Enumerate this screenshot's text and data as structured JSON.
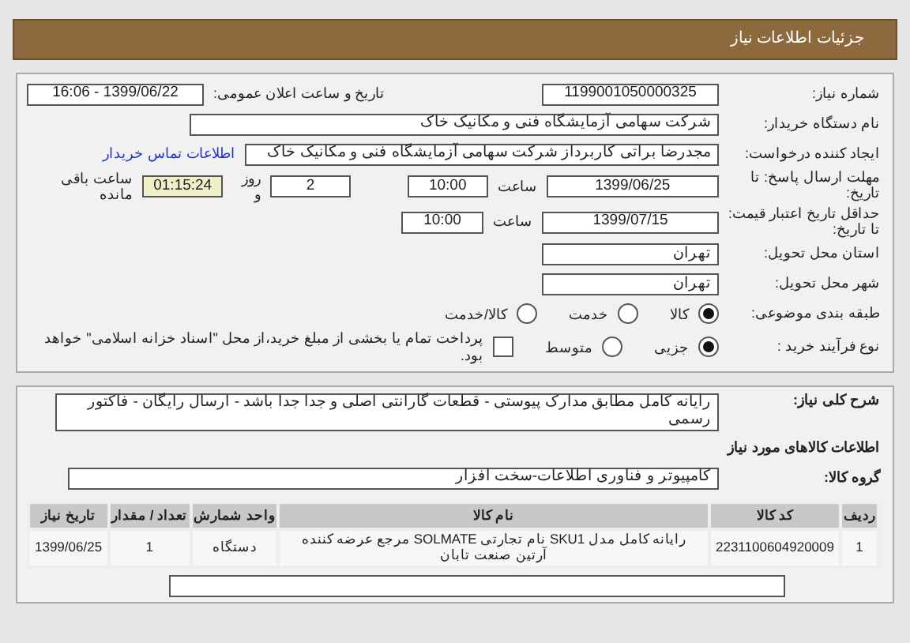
{
  "header": {
    "title": "جزئیات اطلاعات نیاز"
  },
  "need_number": {
    "label": "شماره نیاز:",
    "value": "1199001050000325"
  },
  "announce": {
    "label": "تاریخ و ساعت اعلان عمومی:",
    "value": "1399/06/22 - 16:06"
  },
  "buyer": {
    "label": "نام دستگاه خریدار:",
    "value": "شرکت سهامی آزمایشگاه فنی و مکانیک خاک"
  },
  "creator": {
    "label": "ایجاد کننده درخواست:",
    "value": "مجدرضا براتی کاربرداز  شرکت سهامی آزمایشگاه فنی و مکانیک خاک",
    "link": "اطلاعات تماس خریدار"
  },
  "deadline": {
    "label": "مهلت ارسال پاسخ: تا تاریخ:",
    "date": "1399/06/25",
    "time_label": "ساعت",
    "time": "10:00",
    "days": "2",
    "days_label": "روز و",
    "remaining": "01:15:24",
    "remaining_label": "ساعت باقی مانده"
  },
  "validity": {
    "label": "حداقل تاریخ اعتبار قیمت: تا تاریخ:",
    "date": "1399/07/15",
    "time_label": "ساعت",
    "time": "10:00"
  },
  "province": {
    "label": "استان محل تحویل:",
    "value": "تهران"
  },
  "city": {
    "label": "شهر محل تحویل:",
    "value": "تهران"
  },
  "category": {
    "label": "طبقه بندی موضوعی:",
    "options": [
      {
        "label": "کالا",
        "selected": true
      },
      {
        "label": "خدمت",
        "selected": false
      },
      {
        "label": "کالا/خدمت",
        "selected": false
      }
    ]
  },
  "process": {
    "label": "نوع فرآیند خرید :",
    "options": [
      {
        "label": "جزیی",
        "selected": true
      },
      {
        "label": "متوسط",
        "selected": false
      }
    ],
    "treasury": {
      "label": "پرداخت تمام یا بخشی از مبلغ خرید،از محل \"اسناد خزانه اسلامی\" خواهد بود.",
      "checked": false
    }
  },
  "description": {
    "label": "شرح کلی نیاز:",
    "value": "رایانه کامل مطابق مدارک پیوستی - قطعات گارانتی اصلی و جدا  جدا باشد  - ارسال رایگان - فاکتور رسمی"
  },
  "goods_title": "اطلاعات کالاهای مورد نیاز",
  "goods_group": {
    "label": "گروه کالا:",
    "value": "کامپیوتر و فناوری اطلاعات-سخت افزار"
  },
  "table": {
    "columns": [
      "ردیف",
      "کد کالا",
      "نام کالا",
      "واحد شمارش",
      "تعداد / مقدار",
      "تاریخ نیاز"
    ],
    "rows": [
      [
        "1",
        "2231100604920009",
        "رایانه کامل مدل SKU1 نام تجارتی SOLMATE مرجع عرضه کننده آرتین صنعت تابان",
        "دستگاه",
        "1",
        "1399/06/25"
      ]
    ]
  }
}
